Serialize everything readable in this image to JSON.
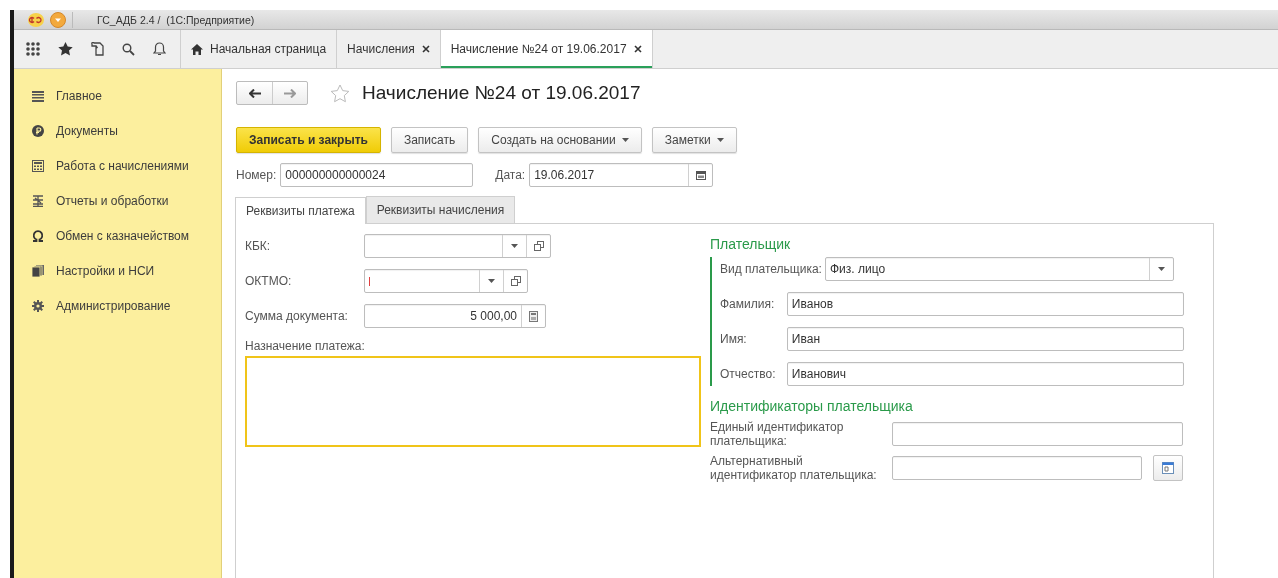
{
  "window": {
    "title": "ГС_АДБ 2.4 /  (1С:Предприятие)"
  },
  "tabs": [
    {
      "label": "Начальная страница",
      "kind": "home",
      "closable": false,
      "selected": false
    },
    {
      "label": "Начисления",
      "kind": "plain",
      "closable": true,
      "selected": false
    },
    {
      "label": "Начисление №24 от 19.06.2017",
      "kind": "plain",
      "closable": true,
      "selected": true
    }
  ],
  "sidebar": {
    "items": [
      {
        "label": "Главное",
        "kind": "lines"
      },
      {
        "label": "Документы",
        "kind": "coin"
      },
      {
        "label": "Работа с начислениями",
        "kind": "calculator"
      },
      {
        "label": "Отчеты и обработки",
        "kind": "report"
      },
      {
        "label": "Обмен с казначейством",
        "kind": "omega"
      },
      {
        "label": "Настройки и НСИ",
        "kind": "stack"
      },
      {
        "label": "Администрирование",
        "kind": "gear"
      }
    ]
  },
  "document": {
    "title": "Начисление №24 от 19.06.2017",
    "favorite": false,
    "buttons": [
      {
        "label": "Записать и закрыть",
        "default": true,
        "dropdown": false
      },
      {
        "label": "Записать",
        "default": false,
        "dropdown": false
      },
      {
        "label": "Создать на основании",
        "default": false,
        "dropdown": true
      },
      {
        "label": "Заметки",
        "default": false,
        "dropdown": true
      }
    ],
    "number": {
      "label": "Номер:",
      "value": "000000000000024"
    },
    "date": {
      "label": "Дата:",
      "value": "19.06.2017"
    },
    "form_tabs": [
      {
        "label": "Реквизиты платежа",
        "selected": true
      },
      {
        "label": "Реквизиты начисления",
        "selected": false
      }
    ],
    "payment": {
      "fields": [
        {
          "label": "КБК:",
          "kind": "select-open",
          "required": false
        },
        {
          "label": "ОКТМО:",
          "kind": "select-open",
          "required": true
        },
        {
          "label": "Сумма документа:",
          "kind": "calc",
          "value": "5 000,00",
          "required": false
        }
      ],
      "purpose": {
        "label": "Назначение платежа:",
        "focused": true
      }
    },
    "payer": {
      "title": "Плательщик",
      "fields": [
        {
          "label": "Вид плательщика:",
          "kind": "select",
          "value": "Физ. лицо"
        },
        {
          "label": "Фамилия:",
          "kind": "text",
          "value": "Иванов"
        },
        {
          "label": "Имя:",
          "kind": "text",
          "value": "Иван"
        },
        {
          "label": "Отчество:",
          "kind": "text",
          "value": "Иванович"
        }
      ]
    },
    "identifiers": {
      "title": "Идентификаторы плательщика",
      "fields": [
        {
          "label": "Единый идентификатор плательщика:",
          "kind": "text"
        },
        {
          "label": "Альтернативный идентификатор плательщика:",
          "kind": "text-button"
        }
      ]
    }
  }
}
